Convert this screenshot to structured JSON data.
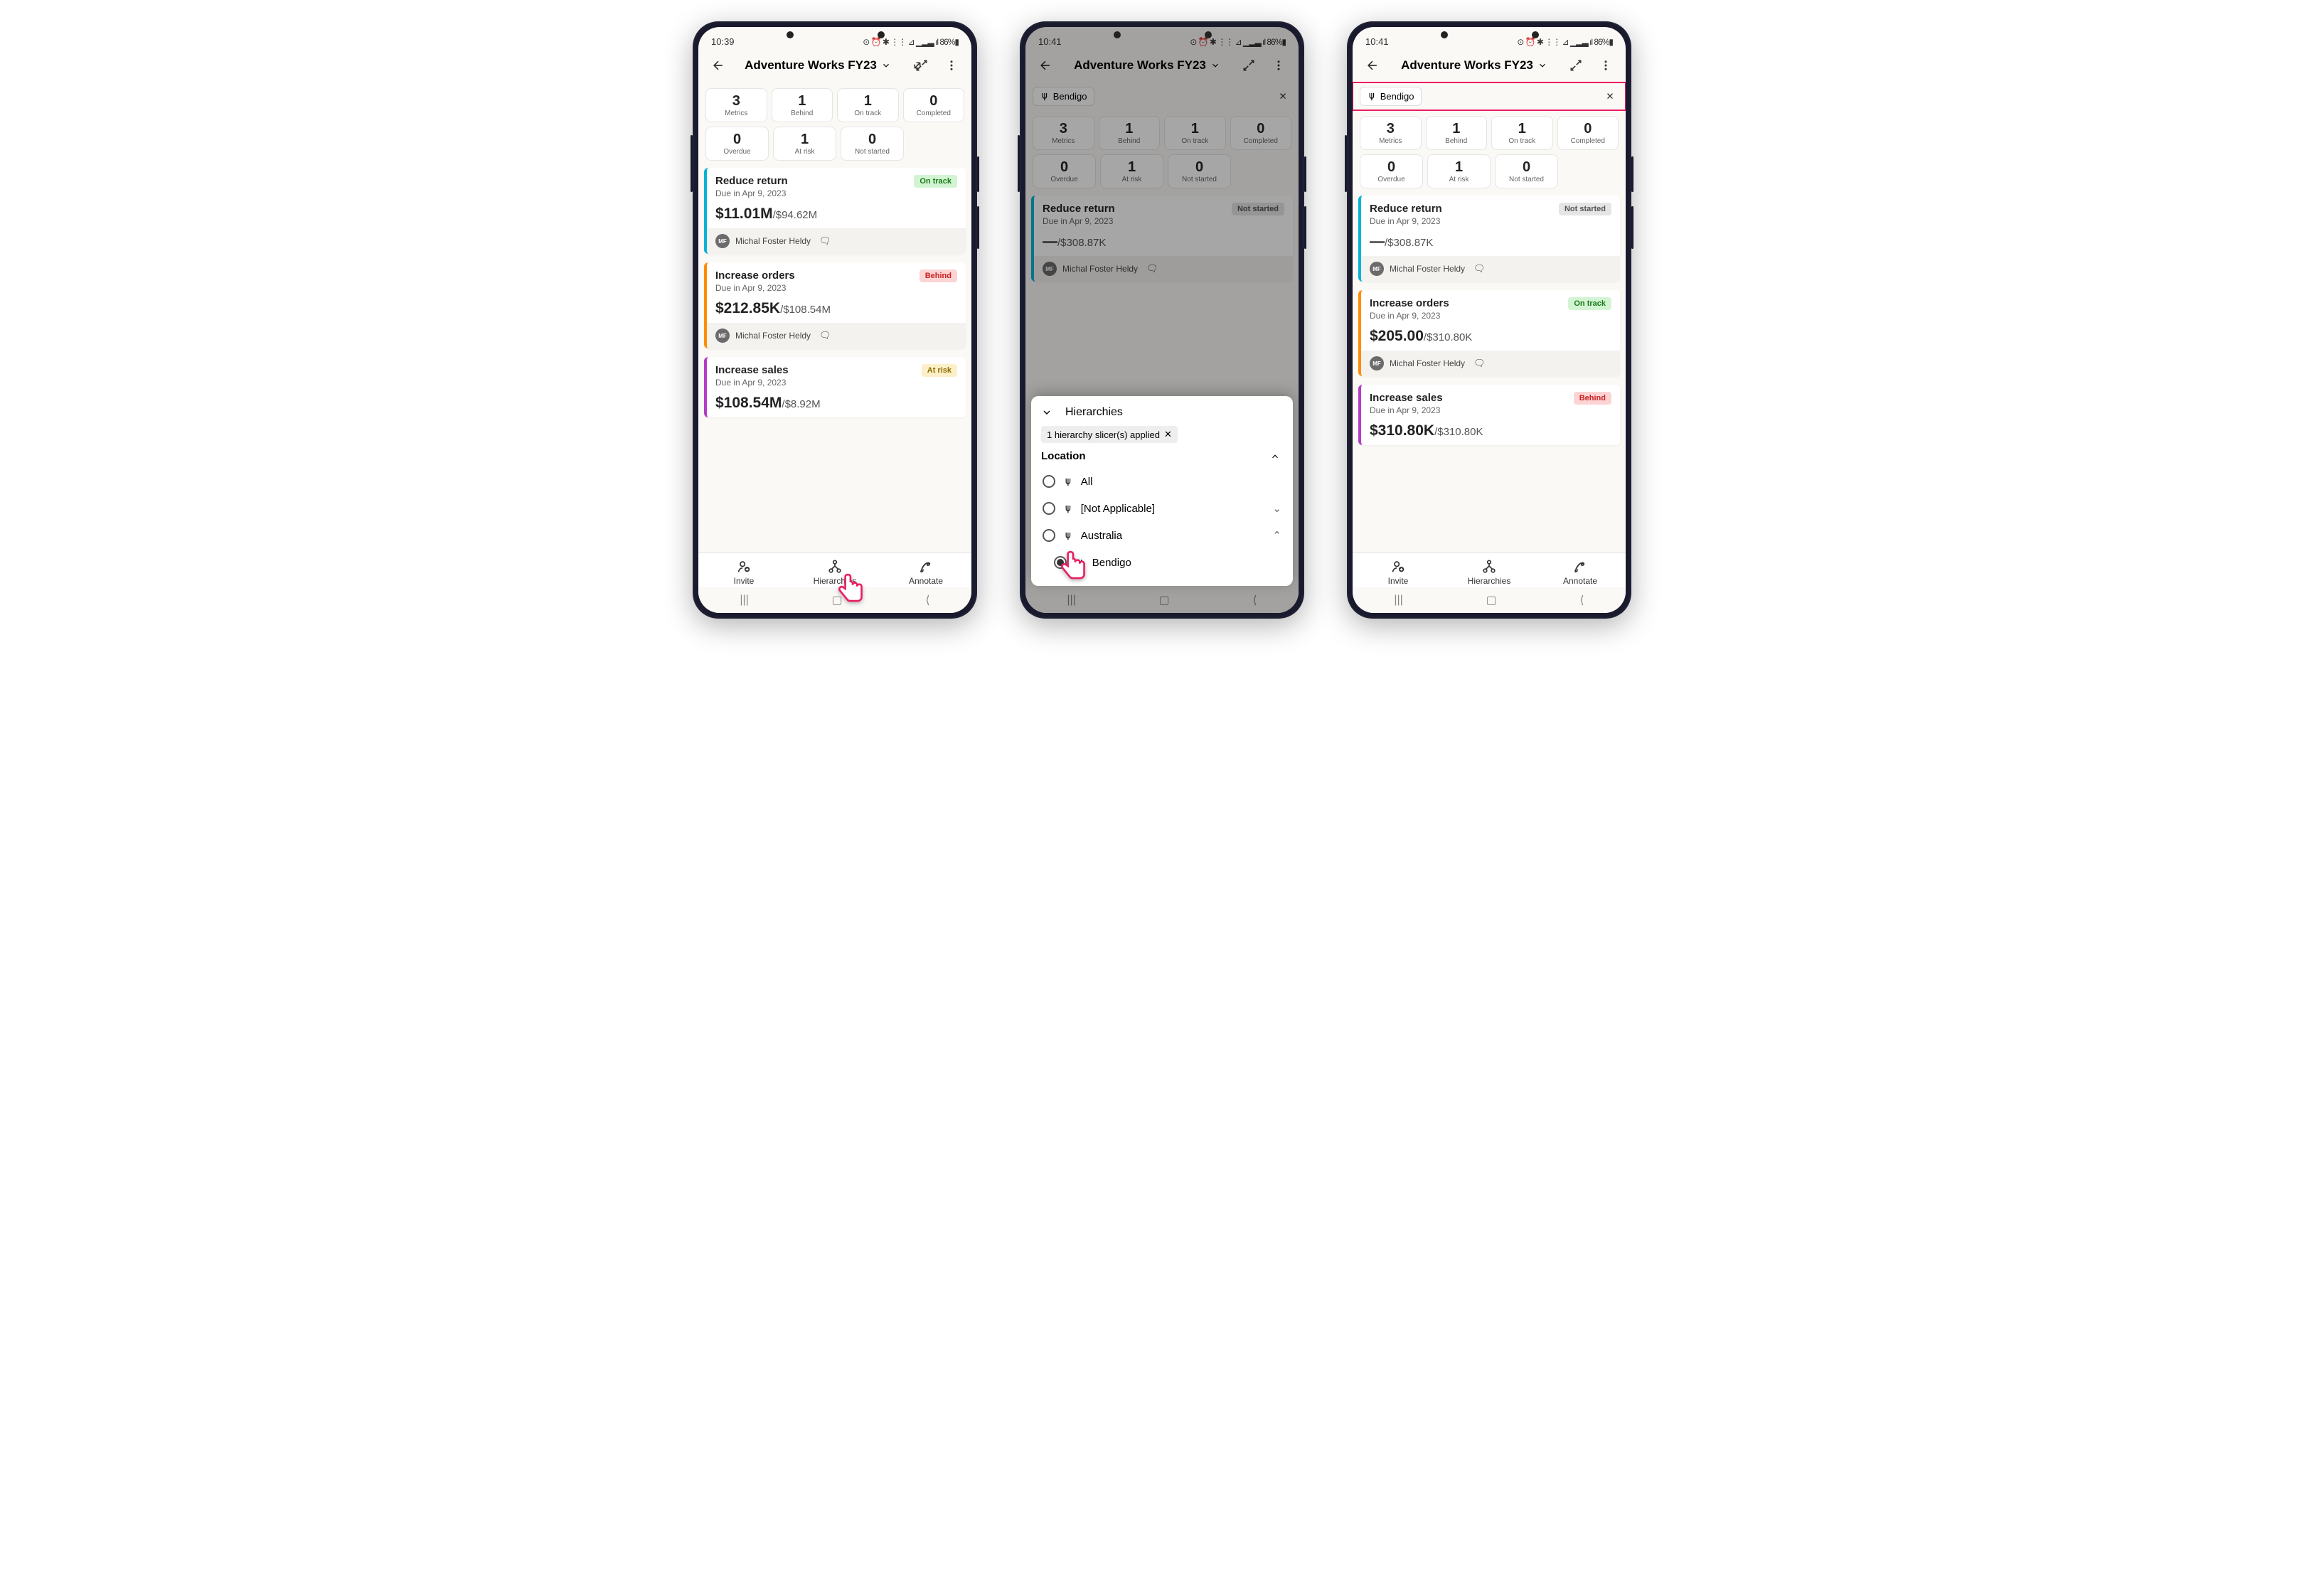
{
  "status_bar": {
    "time1": "10:39",
    "time2": "10:41",
    "time3": "10:41",
    "icons": "⊙ ⏰ ✱ ⋮⋮ ⊿ ▁▂▃ ıl 86%▮"
  },
  "header": {
    "title": "Adventure Works FY23"
  },
  "filter": {
    "chip_label": "Bendigo"
  },
  "stats": {
    "row1": [
      {
        "num": "3",
        "label": "Metrics"
      },
      {
        "num": "1",
        "label": "Behind"
      },
      {
        "num": "1",
        "label": "On track"
      },
      {
        "num": "0",
        "label": "Completed"
      }
    ],
    "row2": [
      {
        "num": "0",
        "label": "Overdue"
      },
      {
        "num": "1",
        "label": "At risk"
      },
      {
        "num": "0",
        "label": "Not started"
      }
    ],
    "row2_filtered": [
      {
        "num": "0",
        "label": "Overdue"
      },
      {
        "num": "1",
        "label": "At risk"
      },
      {
        "num": "0",
        "label": "Not started"
      }
    ]
  },
  "stats_filtered": {
    "row1": [
      {
        "num": "3",
        "label": "Metrics"
      },
      {
        "num": "1",
        "label": "Behind"
      },
      {
        "num": "1",
        "label": "On track"
      },
      {
        "num": "0",
        "label": "Completed"
      }
    ]
  },
  "metrics_a": [
    {
      "name": "Reduce return",
      "due": "Due in Apr 9, 2023",
      "status": "On track",
      "status_class": "ontrack",
      "color": "teal",
      "value": "$11.01M",
      "target": "/$94.62M",
      "owner": "Michal Foster Heldy",
      "initials": "MF"
    },
    {
      "name": "Increase orders",
      "due": "Due in Apr 9, 2023",
      "status": "Behind",
      "status_class": "behind",
      "color": "orange",
      "value": "$212.85K",
      "target": "/$108.54M",
      "owner": "Michal Foster Heldy",
      "initials": "MF"
    },
    {
      "name": "Increase sales",
      "due": "Due in Apr 9, 2023",
      "status": "At risk",
      "status_class": "atrisk",
      "color": "purple",
      "value": "$108.54M",
      "target": "/$8.92M",
      "owner": "",
      "initials": ""
    }
  ],
  "metrics_b": [
    {
      "name": "Reduce return",
      "due": "Due in Apr 9, 2023",
      "status": "Not started",
      "status_class": "notstarted",
      "color": "teal",
      "value": "—",
      "target": "/$308.87K",
      "owner": "Michal Foster Heldy",
      "initials": "MF"
    }
  ],
  "metrics_c": [
    {
      "name": "Reduce return",
      "due": "Due in Apr 9, 2023",
      "status": "Not started",
      "status_class": "notstarted",
      "color": "teal",
      "value": "—",
      "target": "/$308.87K",
      "owner": "Michal Foster Heldy",
      "initials": "MF"
    },
    {
      "name": "Increase orders",
      "due": "Due in Apr 9, 2023",
      "status": "On track",
      "status_class": "ontrack",
      "color": "orange",
      "value": "$205.00",
      "target": "/$310.80K",
      "owner": "Michal Foster Heldy",
      "initials": "MF"
    },
    {
      "name": "Increase sales",
      "due": "Due in Apr 9, 2023",
      "status": "Behind",
      "status_class": "behind",
      "color": "purple",
      "value": "$310.80K",
      "target": "/$310.80K",
      "owner": "",
      "initials": ""
    }
  ],
  "tabs": {
    "invite": "Invite",
    "hierarchies": "Hierarchies",
    "annotate": "Annotate"
  },
  "hierarchies_panel": {
    "title": "Hierarchies",
    "applied": "1 hierarchy slicer(s) applied",
    "section": "Location",
    "items": [
      {
        "label": "All",
        "checked": false,
        "expand": ""
      },
      {
        "label": "[Not Applicable]",
        "checked": false,
        "expand": "⌄"
      },
      {
        "label": "Australia",
        "checked": false,
        "expand": "⌃"
      }
    ],
    "child": {
      "label": "Bendigo",
      "checked": true
    }
  }
}
